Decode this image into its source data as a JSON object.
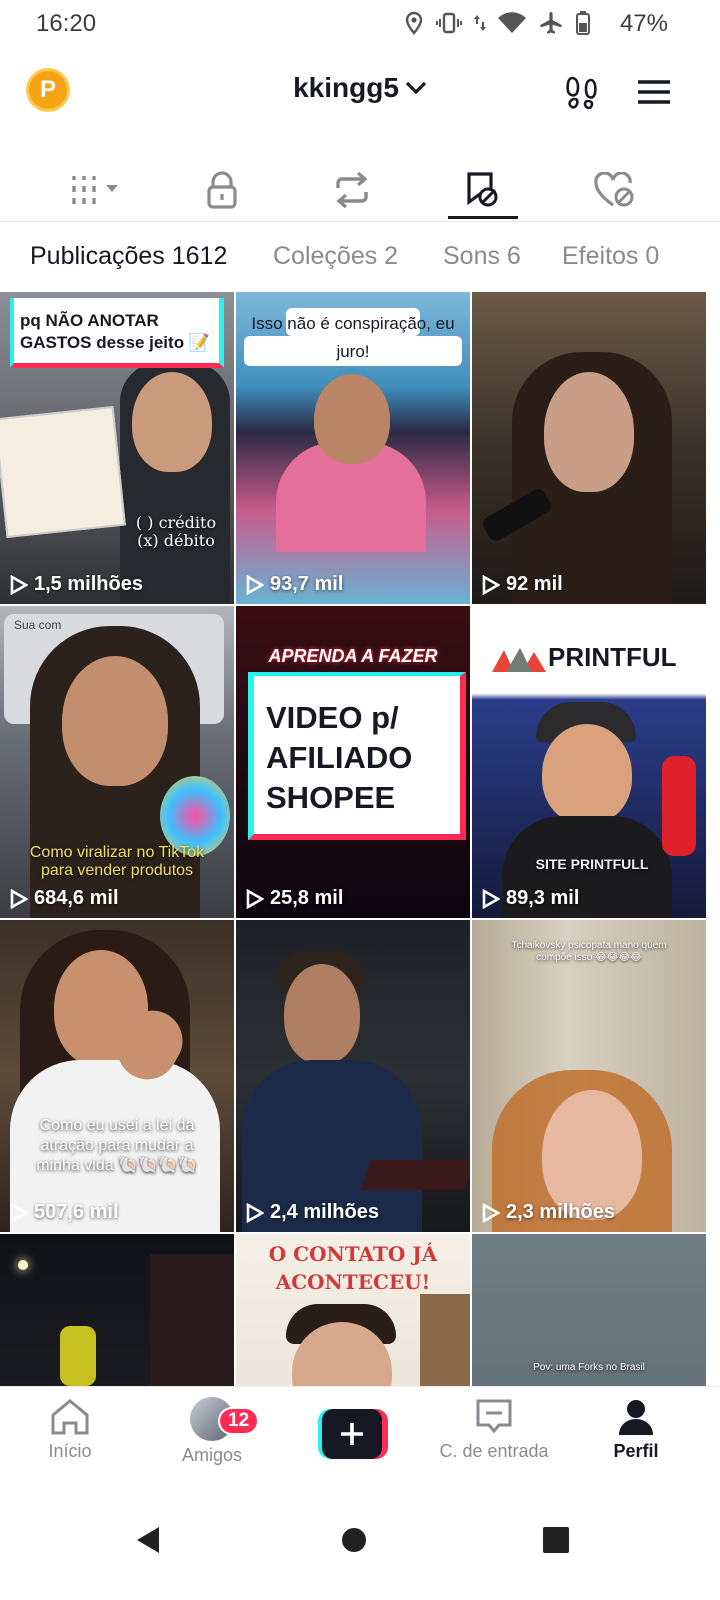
{
  "status_bar": {
    "time": "16:20",
    "battery": "47%"
  },
  "header": {
    "coin_label": "P",
    "username": "kkingg5"
  },
  "icons": {
    "tabs": [
      "grid-filter-icon",
      "lock-icon",
      "repost-icon",
      "bookmark-hidden-icon",
      "heart-hidden-icon"
    ],
    "header_right": [
      "footprints-icon",
      "menu-icon"
    ]
  },
  "sub_tabs": [
    {
      "label": "Publicações 1612",
      "active": true
    },
    {
      "label": "Coleções 2",
      "active": false
    },
    {
      "label": "Sons 6",
      "active": false
    },
    {
      "label": "Efeitos 0",
      "active": false
    }
  ],
  "grid": {
    "tiles": [
      {
        "views": "1,5 milhões",
        "caption": "pq NÃO ANOTAR GASTOS desse jeito 📝",
        "overlay": "( ) crédito (x) débito"
      },
      {
        "views": "93,7 mil",
        "caption": "Isso não é conspiração, eu juro!"
      },
      {
        "views": "92 mil"
      },
      {
        "views": "684,6 mil",
        "caption": "Como viralizar no TikTok para vender produtos",
        "overlay": "Sua com"
      },
      {
        "views": "25,8 mil",
        "caption": "APRENDA A FAZER",
        "overlay": "VIDEO p/ AFILIADO SHOPEE"
      },
      {
        "views": "89,3 mil",
        "caption": "PRINTFUL",
        "overlay": "SITE PRINTFULL"
      },
      {
        "views": "507,6 mil",
        "caption": "Como eu usei a lei da atração para mudar a minha vida 🐚🐚🐚🐚"
      },
      {
        "views": "2,4 milhões"
      },
      {
        "views": "2,3 milhões",
        "caption": "Tchaikovsky psicopata mano quem compõe isso 😂😂😂😂"
      },
      {
        "views": ""
      },
      {
        "views": "",
        "caption": "O CONTATO JÁ ACONTECEU!"
      },
      {
        "views": "",
        "caption": "Pov: uma Forks no Brasil"
      }
    ]
  },
  "bottom_nav": {
    "home": "Início",
    "friends": "Amigos",
    "friends_badge": "12",
    "inbox": "C. de entrada",
    "profile": "Perfil"
  },
  "colors": {
    "accent_red": "#fe2c55",
    "accent_cyan": "#25f4ee",
    "text": "#161823",
    "muted": "#8a8b91"
  }
}
